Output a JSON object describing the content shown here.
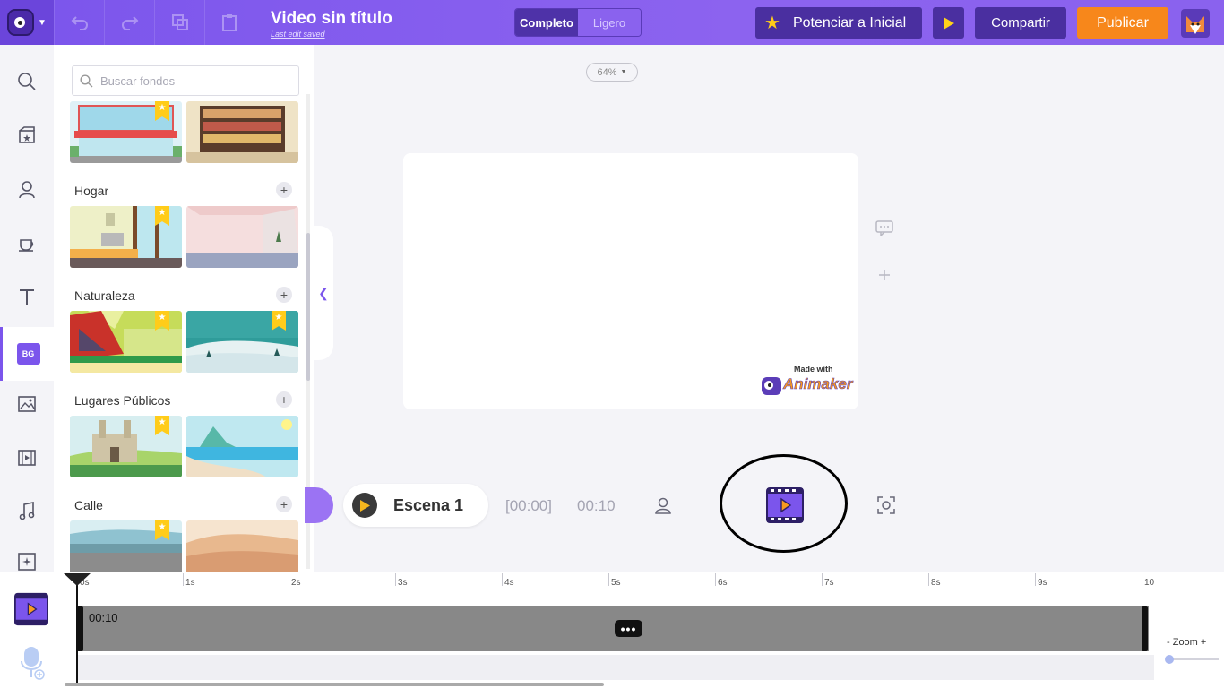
{
  "header": {
    "title": "Video sin título",
    "subtitle": "Last edit saved",
    "mode_options": [
      "Completo",
      "Ligero"
    ],
    "upgrade_label": "Potenciar a Inicial",
    "share_label": "Compartir",
    "publish_label": "Publicar",
    "accent_color": "#7b55ec",
    "publish_color": "#f7871b"
  },
  "rail": {
    "active_label": "BG",
    "items": [
      "search-icon",
      "props-icon",
      "character-icon",
      "coffee-icon",
      "text-icon",
      "bg-icon",
      "image-icon",
      "video-icon",
      "music-icon",
      "effects-icon"
    ]
  },
  "library": {
    "search_placeholder": "Buscar fondos",
    "categories": [
      {
        "label": "Hogar"
      },
      {
        "label": "Naturaleza"
      },
      {
        "label": "Lugares Públicos"
      },
      {
        "label": "Calle"
      }
    ]
  },
  "canvas": {
    "zoom": "64%",
    "watermark_small": "Made with",
    "watermark_brand": "Animaker"
  },
  "scene": {
    "name": "Escena 1",
    "start_time": "[00:00]",
    "duration": "00:10"
  },
  "timeline": {
    "ticks": [
      "0s",
      "1s",
      "2s",
      "3s",
      "4s",
      "5s",
      "6s",
      "7s",
      "8s",
      "9s",
      "10"
    ],
    "track_duration": "00:10",
    "menu_label": "•••",
    "zoom_label": "- Zoom +"
  }
}
